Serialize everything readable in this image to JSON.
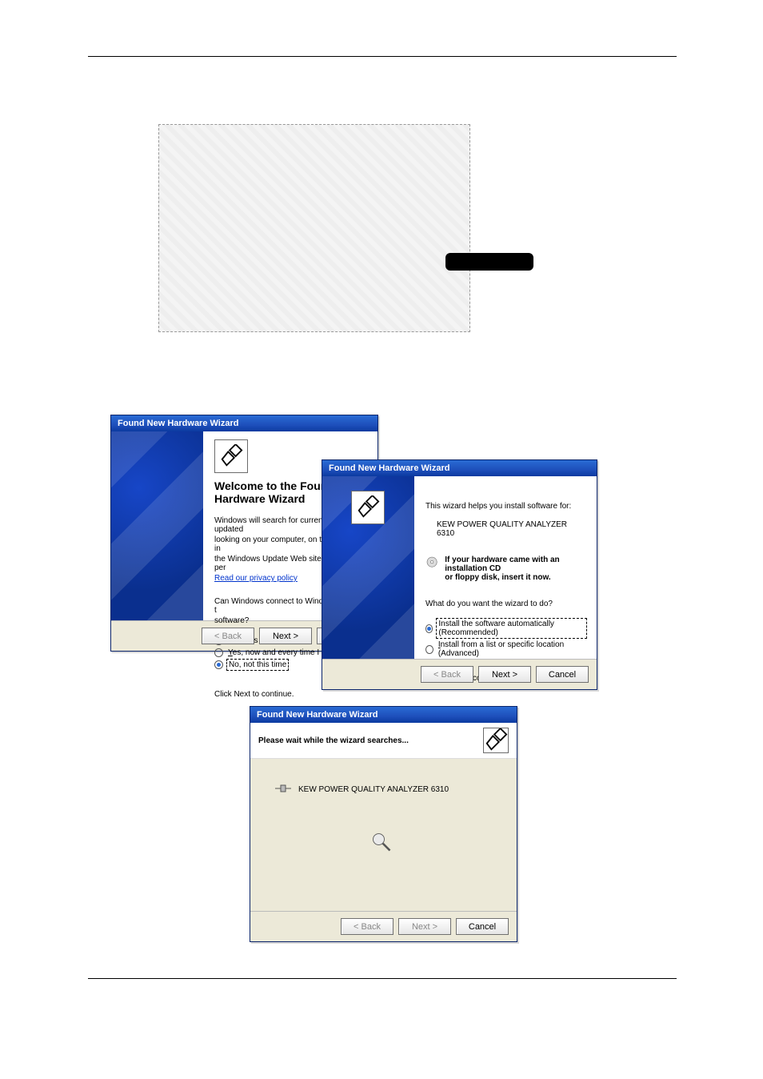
{
  "dialog_title": "Found New Hardware Wizard",
  "buttons": {
    "back": "< Back",
    "next": "Next >",
    "cancel": "Cancel"
  },
  "wiz1": {
    "heading_l1": "Welcome to the Found New",
    "heading_l2": "Hardware Wizard",
    "para_l1": "Windows will search for current and updated",
    "para_l2": "looking on your computer, on the hardware in",
    "para_l3": "the Windows Update Web site (with your per",
    "privacy_link": "Read our privacy policy",
    "q_l1": "Can Windows connect to Windows Update t",
    "q_l2": "software?",
    "opt1": "Yes, this time only",
    "opt2": "Yes, now and every time I connect a d",
    "opt3": "No, not this time",
    "continue": "Click Next to continue."
  },
  "wiz2": {
    "helps_line": "This wizard helps you install software for:",
    "device_name": "KEW POWER QUALITY ANALYZER 6310",
    "cd_l1": "If your hardware came with an installation CD",
    "cd_l2": "or floppy disk, insert it now.",
    "what_do": "What do you want the wizard to do?",
    "opt_auto": "Install the software automatically (Recommended)",
    "opt_list": "Install from a list or specific location (Advanced)",
    "continue": "Click Next to continue."
  },
  "wiz3": {
    "searching": "Please wait while the wizard searches...",
    "device_name": "KEW POWER QUALITY ANALYZER 6310"
  }
}
